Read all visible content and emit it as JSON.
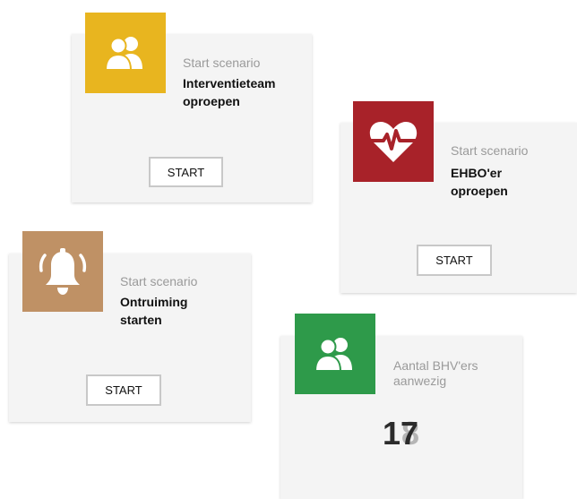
{
  "cards": {
    "intervention": {
      "subtitle": "Start scenario",
      "title_line1": "Interventieteam",
      "title_line2": "oproepen",
      "button_label": "START",
      "accent": "#e8b51f",
      "icon": "users-icon"
    },
    "first_aid": {
      "subtitle": "Start scenario",
      "title_line1": "EHBO'er",
      "title_line2": "oproepen",
      "button_label": "START",
      "accent": "#a82229",
      "icon": "heartbeat-icon"
    },
    "evacuation": {
      "subtitle": "Start scenario",
      "title_line1": "Ontruiming",
      "title_line2": "starten",
      "button_label": "START",
      "accent": "#bf9165",
      "icon": "bell-icon"
    },
    "bhv_present": {
      "label_line1": "Aantal BHV'ers",
      "label_line2": "aanwezig",
      "count": "17",
      "count_ghost": "8",
      "accent": "#2e9a4a",
      "icon": "users-icon"
    }
  }
}
